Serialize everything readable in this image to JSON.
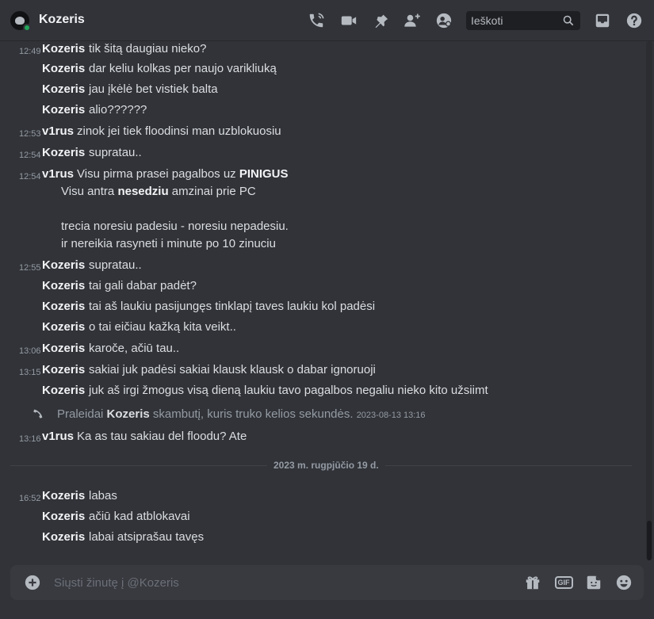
{
  "header": {
    "title": "Kozeris",
    "search_placeholder": "Ieškoti"
  },
  "messages": [
    {
      "ts": "12:49",
      "author": "Kozeris",
      "text": "tik šitą daugiau nieko?"
    },
    {
      "ts": "",
      "author": "Kozeris",
      "text": "dar keliu kolkas per naujo varikliuką"
    },
    {
      "ts": "",
      "author": "Kozeris",
      "text": "jau įkėlė bet vistiek balta"
    },
    {
      "ts": "",
      "author": "Kozeris",
      "text": "alio??????"
    },
    {
      "ts": "12:53",
      "author": "v1rus",
      "text": "zinok jei tiek floodinsi man uzblokuosiu"
    },
    {
      "ts": "12:54",
      "author": "Kozeris",
      "text": "supratau.."
    },
    {
      "ts": "12:54",
      "author": "v1rus",
      "text": "Visu pirma prasei pagalbos uz ",
      "bold": "PINIGUS"
    }
  ],
  "continuation": {
    "line1_a": "Visu antra ",
    "line1_b": "nesedziu",
    "line1_c": " amzinai prie PC",
    "line2": "trecia noresiu padesiu - noresiu nepadesiu.",
    "line3": "ir nereikia rasyneti i minute po 10 zinuciu"
  },
  "messages2": [
    {
      "ts": "12:55",
      "author": "Kozeris",
      "text": "supratau.."
    },
    {
      "ts": "",
      "author": "Kozeris",
      "text": "tai gali dabar padėt?"
    },
    {
      "ts": "",
      "author": "Kozeris",
      "text": "tai aš laukiu pasijungęs tinklapį taves laukiu kol padėsi"
    },
    {
      "ts": "",
      "author": "Kozeris",
      "text": "o tai eičiau kažką kita veikt.."
    },
    {
      "ts": "13:06",
      "author": "Kozeris",
      "text": "karoče, ačiū tau.."
    },
    {
      "ts": "13:15",
      "author": "Kozeris",
      "text": "sakiai juk padėsi sakiai klausk klausk o dabar ignoruoji"
    },
    {
      "ts": "",
      "author": "Kozeris",
      "text": "juk aš irgi žmogus visą dieną laukiu tavo pagalbos negaliu nieko kito užsiimt"
    }
  ],
  "call": {
    "prefix": "Praleidai",
    "name": "Kozeris",
    "suffix": "skambutį, kuris truko kelios sekundės.",
    "ts": "2023-08-13 13:16"
  },
  "message_after_call": {
    "ts": "13:16",
    "author": "v1rus",
    "text": "Ka as tau sakiau del floodu? Ate"
  },
  "divider": "2023 m. rugpjūčio 19 d.",
  "messages3": [
    {
      "ts": "16:52",
      "author": "Kozeris",
      "text": "labas"
    },
    {
      "ts": "",
      "author": "Kozeris",
      "text": "ačiū kad atblokavai"
    },
    {
      "ts": "",
      "author": "Kozeris",
      "text": "labai atsiprašau tavęs"
    }
  ],
  "composer": {
    "placeholder": "Siųsti žinutę į @Kozeris",
    "gif_label": "GIF"
  }
}
